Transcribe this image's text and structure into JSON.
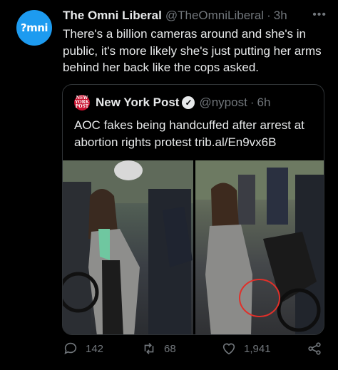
{
  "tweet": {
    "avatar_text": "?mni",
    "author_name": "The Omni Liberal",
    "author_handle": "@TheOmniLiberal",
    "separator": "·",
    "time": "3h",
    "more_icon": "more-icon",
    "text": "There's a billion cameras around and she's in public, it's more likely she's just putting her arms behind her back like the cops asked."
  },
  "quote": {
    "logo_text": "NEW YORK POST",
    "author_name": "New York Post",
    "verified_icon": "verified-badge-icon",
    "author_handle": "@nypost",
    "separator": "·",
    "time": "6h",
    "text": "AOC fakes being handcuffed after arrest at abortion rights protest trib.al/En9vx6B"
  },
  "actions": {
    "reply_count": "142",
    "retweet_count": "68",
    "like_count": "1,941"
  },
  "colors": {
    "background": "#000000",
    "text": "#e7e9ea",
    "secondary": "#71767b",
    "accent": "#1d9bf0",
    "border": "#2f3336",
    "annotation_circle": "#e0302a"
  }
}
